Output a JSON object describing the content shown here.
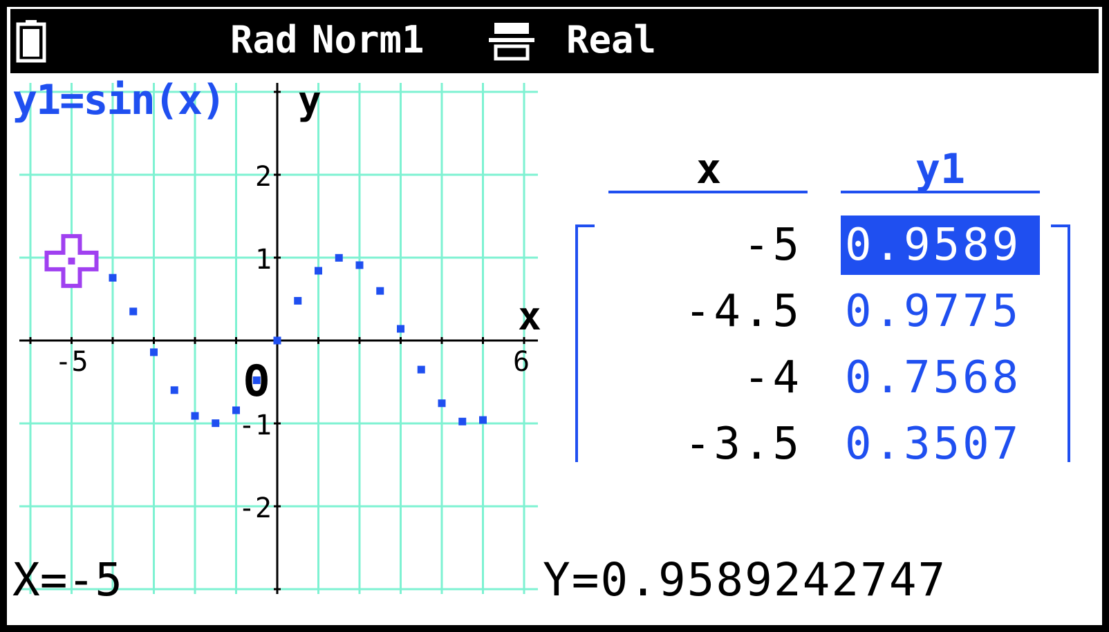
{
  "status_bar": {
    "battery_icon": "battery-icon",
    "angle_mode": "Rad",
    "display_mode": "Norm1",
    "mode_icon": "fraction-mode-icon",
    "number_mode": "Real"
  },
  "graph": {
    "equation": "y1=sin(x)",
    "axis_x_label": "x",
    "axis_y_label": "y",
    "origin_label": "O",
    "x_tick_labels": [
      "-5",
      "6"
    ],
    "y_tick_labels": [
      "2",
      "1",
      "-1",
      "-2"
    ],
    "trace_cursor_icon": "trace-cursor-icon",
    "grid_color": "#7ef2d2",
    "point_color": "#1f4ff0",
    "cursor_color": "#a040f0",
    "chart_data": {
      "type": "scatter",
      "series": [
        {
          "name": "y1",
          "points": [
            [
              -5,
              0.9589
            ],
            [
              -4.5,
              0.9775
            ],
            [
              -4,
              0.7568
            ],
            [
              -3.5,
              0.3507
            ],
            [
              -3,
              -0.1411
            ],
            [
              -2.5,
              -0.5985
            ],
            [
              -2,
              -0.9093
            ],
            [
              -1.5,
              -0.9975
            ],
            [
              -1,
              -0.8415
            ],
            [
              -0.5,
              -0.4794
            ],
            [
              0,
              0
            ],
            [
              0.5,
              0.4794
            ],
            [
              1,
              0.8415
            ],
            [
              1.5,
              0.9975
            ],
            [
              2,
              0.9093
            ],
            [
              2.5,
              0.5985
            ],
            [
              3,
              0.1411
            ],
            [
              3.5,
              -0.3508
            ],
            [
              4,
              -0.7568
            ],
            [
              4.5,
              -0.9775
            ],
            [
              5,
              -0.9589
            ]
          ]
        }
      ],
      "cursor": [
        -5,
        0.9589
      ],
      "xlim": [
        -6.7,
        6.1
      ],
      "ylim": [
        -3.1,
        3.1
      ],
      "grid": true
    }
  },
  "table": {
    "col_x_header": "x",
    "col_y_header": "y1",
    "rows": [
      {
        "x": "-5",
        "y": "0.9589"
      },
      {
        "x": "-4.5",
        "y": "0.9775"
      },
      {
        "x": "-4",
        "y": "0.7568"
      },
      {
        "x": "-3.5",
        "y": "0.3507"
      }
    ],
    "selected_row": 0
  },
  "readout": {
    "x": "X=-5",
    "y": "Y=0.9589242747"
  }
}
